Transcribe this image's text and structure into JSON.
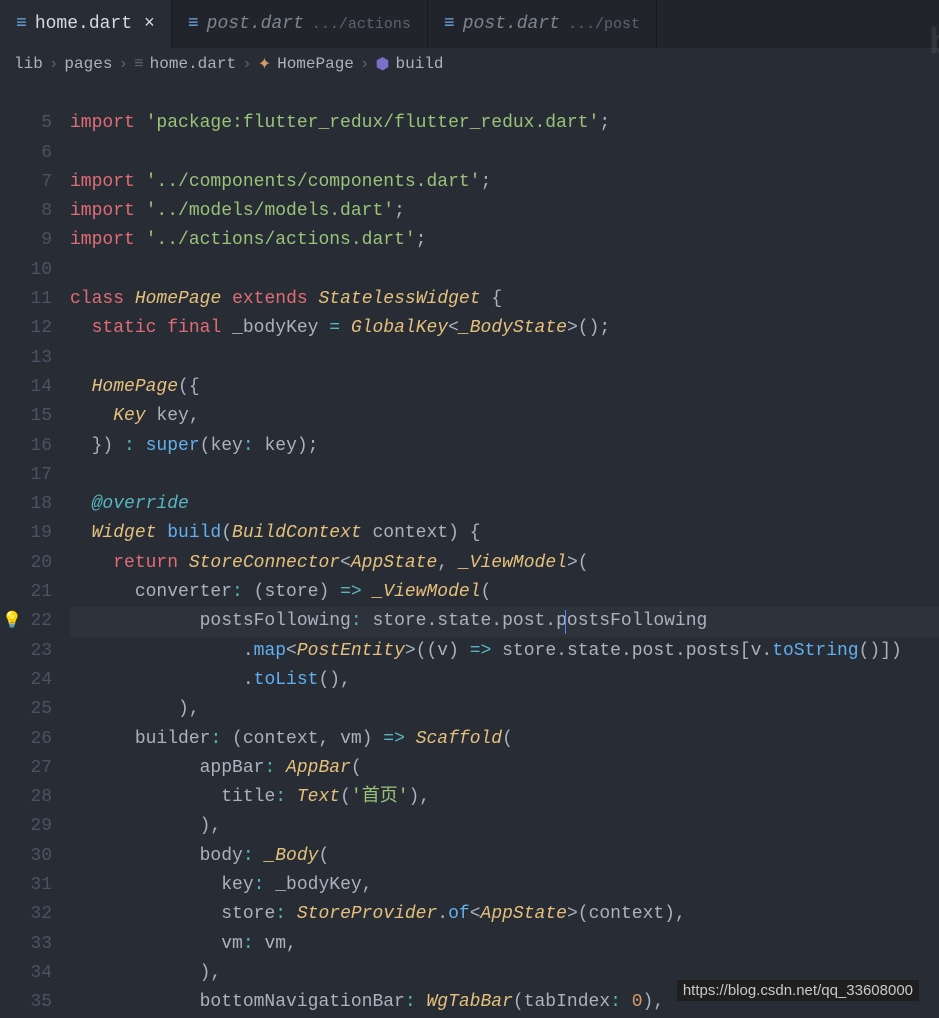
{
  "tabs": [
    {
      "icon": "≡",
      "name": "home.dart",
      "path": "",
      "active": true,
      "closeable": true
    },
    {
      "icon": "≡",
      "name": "post.dart",
      "path": ".../actions",
      "active": false,
      "closeable": false
    },
    {
      "icon": "≡",
      "name": "post.dart",
      "path": ".../post",
      "active": false,
      "closeable": false
    }
  ],
  "breadcrumb": {
    "parts": [
      "lib",
      "pages",
      "home.dart",
      "HomePage",
      "build"
    ],
    "sep": "›"
  },
  "lines": {
    "start": 5,
    "end": 35
  },
  "watermark": "b",
  "url": "https://blog.csdn.net/qq_33608000",
  "lightbulb_line": 22,
  "code": {
    "l5": {
      "kw": "import",
      "str": "'package:flutter_redux/flutter_redux.dart'",
      "semi": ";"
    },
    "l7": {
      "kw": "import",
      "str": "'../components/components.dart'",
      "semi": ";"
    },
    "l8": {
      "kw": "import",
      "str": "'../models/models.dart'",
      "semi": ";"
    },
    "l9": {
      "kw": "import",
      "str": "'../actions/actions.dart'",
      "semi": ";"
    },
    "l11": {
      "kw1": "class",
      "type1": "HomePage",
      "kw2": "extends",
      "type2": "StatelessWidget",
      "brace": " {"
    },
    "l12": {
      "kw1": "static",
      "kw2": "final",
      "name": "_bodyKey",
      "eq": " = ",
      "type1": "GlobalKey",
      "lt": "<",
      "type2": "_BodyState",
      "gt": ">",
      "call": "();"
    },
    "l14": {
      "type": "HomePage",
      "open": "({"
    },
    "l15": {
      "type": "Key",
      "name": " key,"
    },
    "l16": {
      "close": "}) ",
      "colon": ":",
      "sup": " super",
      "args": "(key",
      "c2": ":",
      "args2": " key);"
    },
    "l18": {
      "ann": "@override"
    },
    "l19": {
      "type": "Widget",
      "fn": " build",
      "open": "(",
      "ptype": "BuildContext",
      "pname": " context) {"
    },
    "l20": {
      "kw": "return",
      "type1": " StoreConnector",
      "lt": "<",
      "type2": "AppState",
      "comma": ", ",
      "type3": "_ViewModel",
      "gt": ">",
      "open": "("
    },
    "l21": {
      "prop": "converter",
      "colon": ":",
      "args": " (store) ",
      "arrow": "=>",
      "type": " _ViewModel",
      "open": "("
    },
    "l22": {
      "prop": "postsFollowing",
      "colon": ":",
      "expr": " store.state.post.postsFollowing"
    },
    "l23": {
      "dot": ".",
      "fn": "map",
      "lt": "<",
      "type": "PostEntity",
      "gt": ">",
      "args1": "((v) ",
      "arrow": "=>",
      "args2": " store.state.post.posts[v.",
      "fn2": "toString",
      "args3": "()])"
    },
    "l24": {
      "dot": ".",
      "fn": "toList",
      "call": "(),"
    },
    "l25": {
      "close": "),"
    },
    "l26": {
      "prop": "builder",
      "colon": ":",
      "args": " (context, vm) ",
      "arrow": "=>",
      "type": " Scaffold",
      "open": "("
    },
    "l27": {
      "prop": "appBar",
      "colon": ":",
      "type": " AppBar",
      "open": "("
    },
    "l28": {
      "prop": "title",
      "colon": ":",
      "type": " Text",
      "open": "(",
      "str": "'首页'",
      "close": "),"
    },
    "l29": {
      "close": "),"
    },
    "l30": {
      "prop": "body",
      "colon": ":",
      "type": " _Body",
      "open": "("
    },
    "l31": {
      "prop": "key",
      "colon": ":",
      "val": " _bodyKey,"
    },
    "l32": {
      "prop": "store",
      "colon": ":",
      "type": " StoreProvider",
      "dot": ".",
      "fn": "of",
      "lt": "<",
      "type2": "AppState",
      "gt": ">",
      "args": "(context),"
    },
    "l33": {
      "prop": "vm",
      "colon": ":",
      "val": " vm,"
    },
    "l34": {
      "close": "),"
    },
    "l35": {
      "prop": "bottomNavigationBar",
      "colon": ":",
      "type": " WgTabBar",
      "open": "(",
      "prop2": "tabIndex",
      "c2": ":",
      "num": " 0",
      "close": "),"
    }
  }
}
